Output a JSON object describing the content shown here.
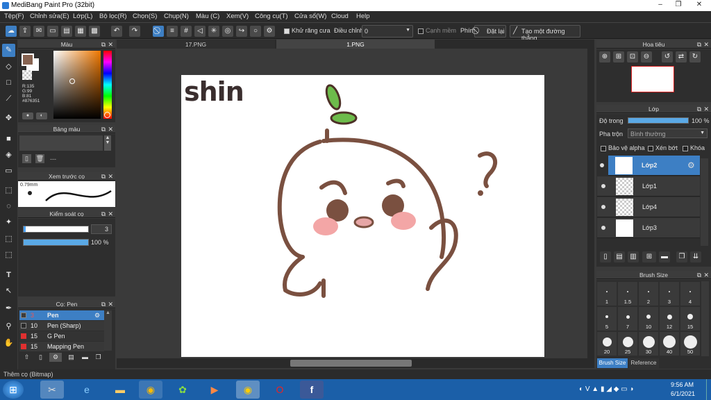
{
  "window": {
    "title": "MediBang Paint Pro (32bit)",
    "controls": [
      "–",
      "❐",
      "✕"
    ]
  },
  "menu": [
    "Tệp(F)",
    "Chỉnh sửa(E)",
    "Lớp(L)",
    "Bộ lọc(R)",
    "Chọn(S)",
    "Chụp(N)",
    "Màu (C)",
    "Xem(V)",
    "Công cụ(T)",
    "Cửa sổ(W)",
    "Cloud",
    "Help"
  ],
  "toolbar": {
    "antialias": "Khử răng cưa",
    "correction": "Điều chỉnh",
    "correction_value": "0",
    "edge": "Cạnh mềm",
    "key": "Phím",
    "set_layer": "Đặt lại",
    "straight_line": "Tạo một đường thẳng"
  },
  "tabs": [
    "17.PNG",
    "1.PNG"
  ],
  "color_panel": {
    "title": "Màu",
    "r": "R:135",
    "g": "G:99",
    "b": "B:81",
    "hex": "#876351",
    "main_color": "#876351"
  },
  "palette_panel": {
    "title": "Bảng màu",
    "extra": "---"
  },
  "brush_preview": {
    "title": "Xem trước cọ",
    "size": "0.79mm"
  },
  "brush_control": {
    "title": "Kiểm soát cọ",
    "size_value": "3",
    "opacity_value": "100 %"
  },
  "brush_list": {
    "title": "Cọ: Pen",
    "items": [
      {
        "size": "3",
        "name": "Pen",
        "color": "#3c3c3c",
        "selected": true
      },
      {
        "size": "10",
        "name": "Pen (Sharp)",
        "color": "#2a2a2a",
        "selected": false
      },
      {
        "size": "15",
        "name": "G Pen",
        "color": "#e03030",
        "selected": false
      },
      {
        "size": "15",
        "name": "Mapping Pen",
        "color": "#e03030",
        "selected": false
      }
    ]
  },
  "navigator": {
    "title": "Hoa tiêu"
  },
  "layer_panel": {
    "title": "Lớp",
    "opacity_label": "Độ trong",
    "opacity_value": "100 %",
    "blend_label": "Pha trộn",
    "blend_value": "Bình thường",
    "protect_alpha": "Bảo vệ alpha",
    "clipping": "Xén bớt",
    "lock": "Khóa",
    "layers": [
      {
        "name": "Lớp2",
        "selected": true
      },
      {
        "name": "Lớp1",
        "selected": false
      },
      {
        "name": "Lớp4",
        "selected": false
      },
      {
        "name": "Lớp3",
        "selected": false
      }
    ]
  },
  "brush_size": {
    "title": "Brush Size",
    "sizes": [
      "1",
      "1.5",
      "2",
      "3",
      "4",
      "5",
      "7",
      "10",
      "12",
      "15",
      "20",
      "25",
      "30",
      "40",
      "50"
    ],
    "tabs": [
      "Brush Size",
      "Reference"
    ]
  },
  "canvas": {
    "text": "shin"
  },
  "status": "Thêm cọ (Bitmap)",
  "clock": {
    "time": "9:56 AM",
    "date": "6/1/2021"
  }
}
